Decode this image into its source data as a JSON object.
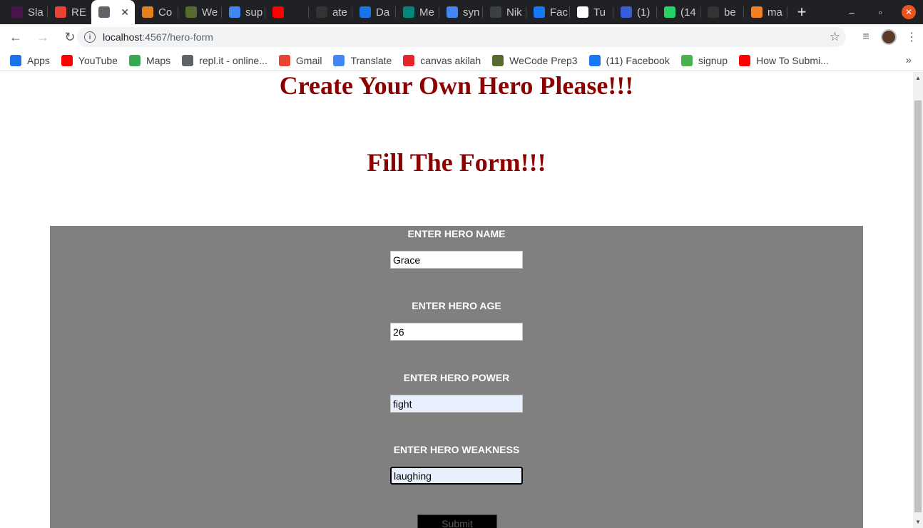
{
  "browser": {
    "tabs": [
      {
        "label": "Sla",
        "icon": "slack-icon",
        "color": "#4a154b"
      },
      {
        "label": "RE",
        "icon": "gmail-icon",
        "color": "#ea4335"
      },
      {
        "label": "",
        "icon": "globe-icon",
        "color": "#5f6368",
        "active": true
      },
      {
        "label": "Co",
        "icon": "codewars-icon",
        "color": "#e67e22"
      },
      {
        "label": "We",
        "icon": "wecode-icon",
        "color": "#556b2f"
      },
      {
        "label": "sup",
        "icon": "google-icon",
        "color": "#4285f4"
      },
      {
        "label": "",
        "icon": "youtube-icon",
        "color": "#ff0000"
      },
      {
        "label": "ate",
        "icon": "github-icon",
        "color": "#333333"
      },
      {
        "label": "Da",
        "icon": "calendar-icon",
        "color": "#1a73e8"
      },
      {
        "label": "Me",
        "icon": "meet-icon",
        "color": "#00897b"
      },
      {
        "label": "syn",
        "icon": "google-icon",
        "color": "#4285f4"
      },
      {
        "label": "Nik",
        "icon": "globe-icon",
        "color": "#3c4043"
      },
      {
        "label": "Fac",
        "icon": "facebook-icon",
        "color": "#1877f2"
      },
      {
        "label": "Tu",
        "icon": "tutorial-icon",
        "color": "#ffffff"
      },
      {
        "label": "(1)",
        "icon": "hex-icon",
        "color": "#3b5bdb"
      },
      {
        "label": "(14",
        "icon": "whatsapp-icon",
        "color": "#25d366"
      },
      {
        "label": "be",
        "icon": "github-icon",
        "color": "#333333"
      },
      {
        "label": "ma",
        "icon": "stackoverflow-icon",
        "color": "#f48024"
      }
    ],
    "url_host": "localhost",
    "url_path": ":4567/hero-form",
    "bookmarks": [
      {
        "label": "Apps",
        "icon": "apps-grid-icon",
        "color": "#1a73e8"
      },
      {
        "label": "YouTube",
        "icon": "youtube-icon",
        "color": "#ff0000"
      },
      {
        "label": "Maps",
        "icon": "maps-icon",
        "color": "#34a853"
      },
      {
        "label": "repl.it - online...",
        "icon": "replit-icon",
        "color": "#5f6368"
      },
      {
        "label": "Gmail",
        "icon": "gmail-icon",
        "color": "#ea4335"
      },
      {
        "label": "Translate",
        "icon": "translate-icon",
        "color": "#4285f4"
      },
      {
        "label": "canvas akilah",
        "icon": "canvas-icon",
        "color": "#e4262c"
      },
      {
        "label": "WeCode Prep3",
        "icon": "wecode-icon",
        "color": "#556b2f"
      },
      {
        "label": "(11) Facebook",
        "icon": "facebook-icon",
        "color": "#1877f2"
      },
      {
        "label": "signup",
        "icon": "signup-icon",
        "color": "#4caf50"
      },
      {
        "label": "How To Submi...",
        "icon": "youtube-icon",
        "color": "#ff0000"
      }
    ],
    "more_bookmarks": "»"
  },
  "page": {
    "title": "Create Your Own Hero Please!!!",
    "subtitle": "Fill The Form!!!",
    "form": {
      "name_label": "ENTER HERO NAME",
      "name_value": "Grace",
      "age_label": "ENTER HERO AGE",
      "age_value": "26",
      "power_label": "ENTER HERO POWER",
      "power_value": "fight",
      "weakness_label": "ENTER HERO WEAKNESS",
      "weakness_value": "laughing",
      "submit_label": "Submit"
    }
  },
  "colors": {
    "heading": "#8b0000",
    "form_bg": "#808080",
    "autofill_bg": "#e8f0fe"
  }
}
